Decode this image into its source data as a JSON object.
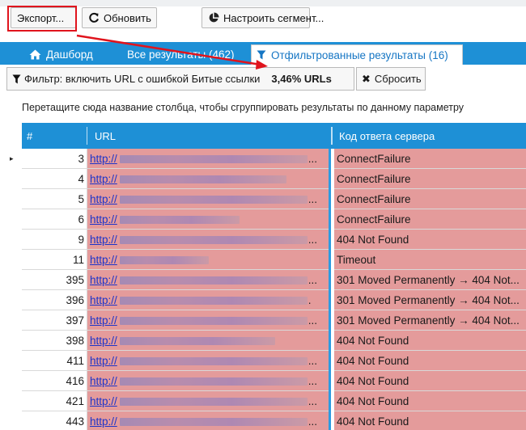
{
  "toolbar": {
    "export_label": "Экспорт...",
    "refresh_label": "Обновить",
    "segment_label": "Настроить сегмент..."
  },
  "tabs": [
    {
      "label": "Дашборд",
      "icon": "home-icon",
      "active": false
    },
    {
      "label": "Все результаты (462)",
      "icon": "",
      "active": false
    },
    {
      "label": "Отфильтрованные результаты (16)",
      "icon": "filter-icon",
      "active": true
    }
  ],
  "filter": {
    "label": "Фильтр: включить URL с ошибкой Битые ссылки",
    "percent": "3,46% URLs",
    "reset_label": "Сбросить"
  },
  "group_hint": "Перетащите сюда название столбца, чтобы сгруппировать результаты по данному параметру",
  "columns": {
    "num": "#",
    "url": "URL",
    "code": "Код ответа сервера"
  },
  "rows": [
    {
      "num": "3",
      "url": "http://",
      "code": "ConnectFailure",
      "blur": 232,
      "dots": "..."
    },
    {
      "num": "4",
      "url": "http://",
      "code": "ConnectFailure",
      "blur": 206,
      "dots": ""
    },
    {
      "num": "5",
      "url": "http://",
      "code": "ConnectFailure",
      "blur": 232,
      "dots": "..."
    },
    {
      "num": "6",
      "url": "http://",
      "code": "ConnectFailure",
      "blur": 148,
      "dots": ""
    },
    {
      "num": "9",
      "url": "http://",
      "code": "404 Not Found",
      "blur": 232,
      "dots": "..."
    },
    {
      "num": "11",
      "url": "http://",
      "code": "Timeout",
      "blur": 110,
      "dots": ""
    },
    {
      "num": "395",
      "url": "http://",
      "code": "301 Moved Permanently → 404 Not...",
      "blur": 232,
      "dots": "..."
    },
    {
      "num": "396",
      "url": "http://",
      "code": "301 Moved Permanently → 404 Not...",
      "blur": 232,
      "dots": "."
    },
    {
      "num": "397",
      "url": "http://",
      "code": "301 Moved Permanently → 404 Not...",
      "blur": 232,
      "dots": "..."
    },
    {
      "num": "398",
      "url": "http://",
      "code": "404 Not Found",
      "blur": 192,
      "dots": ""
    },
    {
      "num": "411",
      "url": "http://",
      "code": "404 Not Found",
      "blur": 232,
      "dots": "..."
    },
    {
      "num": "416",
      "url": "http://",
      "code": "404 Not Found",
      "blur": 232,
      "dots": "..."
    },
    {
      "num": "421",
      "url": "http://",
      "code": "404 Not Found",
      "blur": 232,
      "dots": "..."
    },
    {
      "num": "443",
      "url": "http://",
      "code": "404 Not Found",
      "blur": 232,
      "dots": "..."
    }
  ],
  "colors": {
    "accent": "#1e90d6",
    "error_row": "#e49b9b",
    "highlight": "#e0141d",
    "link": "#1d34c8"
  }
}
